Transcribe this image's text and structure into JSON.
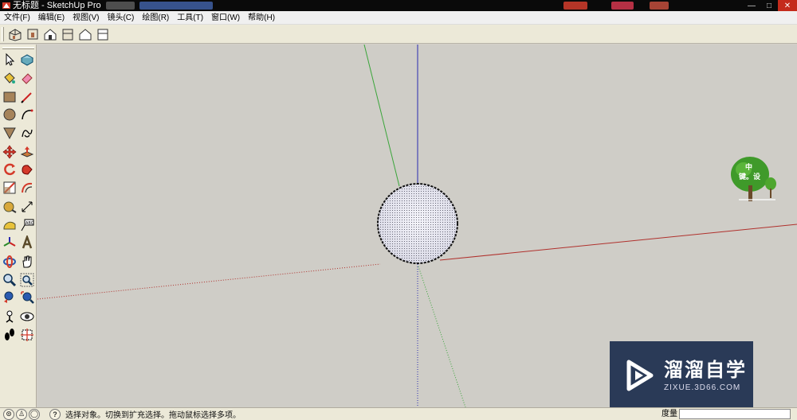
{
  "window": {
    "title": "无标题 - SketchUp Pro",
    "controls": {
      "minimize": "—",
      "maximize": "□",
      "close": "✕"
    }
  },
  "menu": {
    "items": [
      "文件(F)",
      "编辑(E)",
      "视图(V)",
      "镜头(C)",
      "绘图(R)",
      "工具(T)",
      "窗口(W)",
      "帮助(H)"
    ]
  },
  "views_toolbar": {
    "icons": [
      "iso-view-icon",
      "top-view-icon",
      "front-view-icon",
      "right-view-icon",
      "back-view-icon",
      "left-view-icon"
    ]
  },
  "tools": {
    "rows": [
      [
        "select-arrow-icon",
        "make-component-icon"
      ],
      [
        "paint-bucket-icon",
        "eraser-icon"
      ],
      [
        "rectangle-icon",
        "pencil-line-icon"
      ],
      [
        "circle-icon",
        "arc-icon"
      ],
      [
        "polygon-icon",
        "freehand-icon"
      ],
      [
        "move-icon",
        "push-pull-icon"
      ],
      [
        "rotate-icon",
        "follow-me-icon"
      ],
      [
        "scale-icon",
        "offset-icon"
      ],
      [
        "tape-measure-icon",
        "dimension-icon"
      ],
      [
        "protractor-icon",
        "text-label-icon"
      ],
      [
        "axes-icon",
        "3d-text-icon"
      ],
      [
        "orbit-icon",
        "pan-hand-icon"
      ],
      [
        "zoom-icon",
        "zoom-window-icon"
      ],
      [
        "zoom-previous-icon",
        "zoom-extents-icon"
      ],
      [
        "position-camera-icon",
        "look-around-icon"
      ],
      [
        "walk-icon",
        "section-plane-icon"
      ]
    ]
  },
  "colors": {
    "viewport_bg": "#cfcdc7",
    "axis_red": "#b0302c",
    "axis_green": "#3aa53a",
    "axis_blue": "#2a2ab0",
    "watermark_bg": "#2a3a57"
  },
  "tree_badge": {
    "line1": "中",
    "line2": "键。设"
  },
  "watermark": {
    "title": "溜溜自学",
    "url": "ZIXUE.3D66.COM"
  },
  "status": {
    "hint": "选择对象。切换到扩充选择。拖动鼠标选择多项。",
    "measure_label": "度量"
  }
}
